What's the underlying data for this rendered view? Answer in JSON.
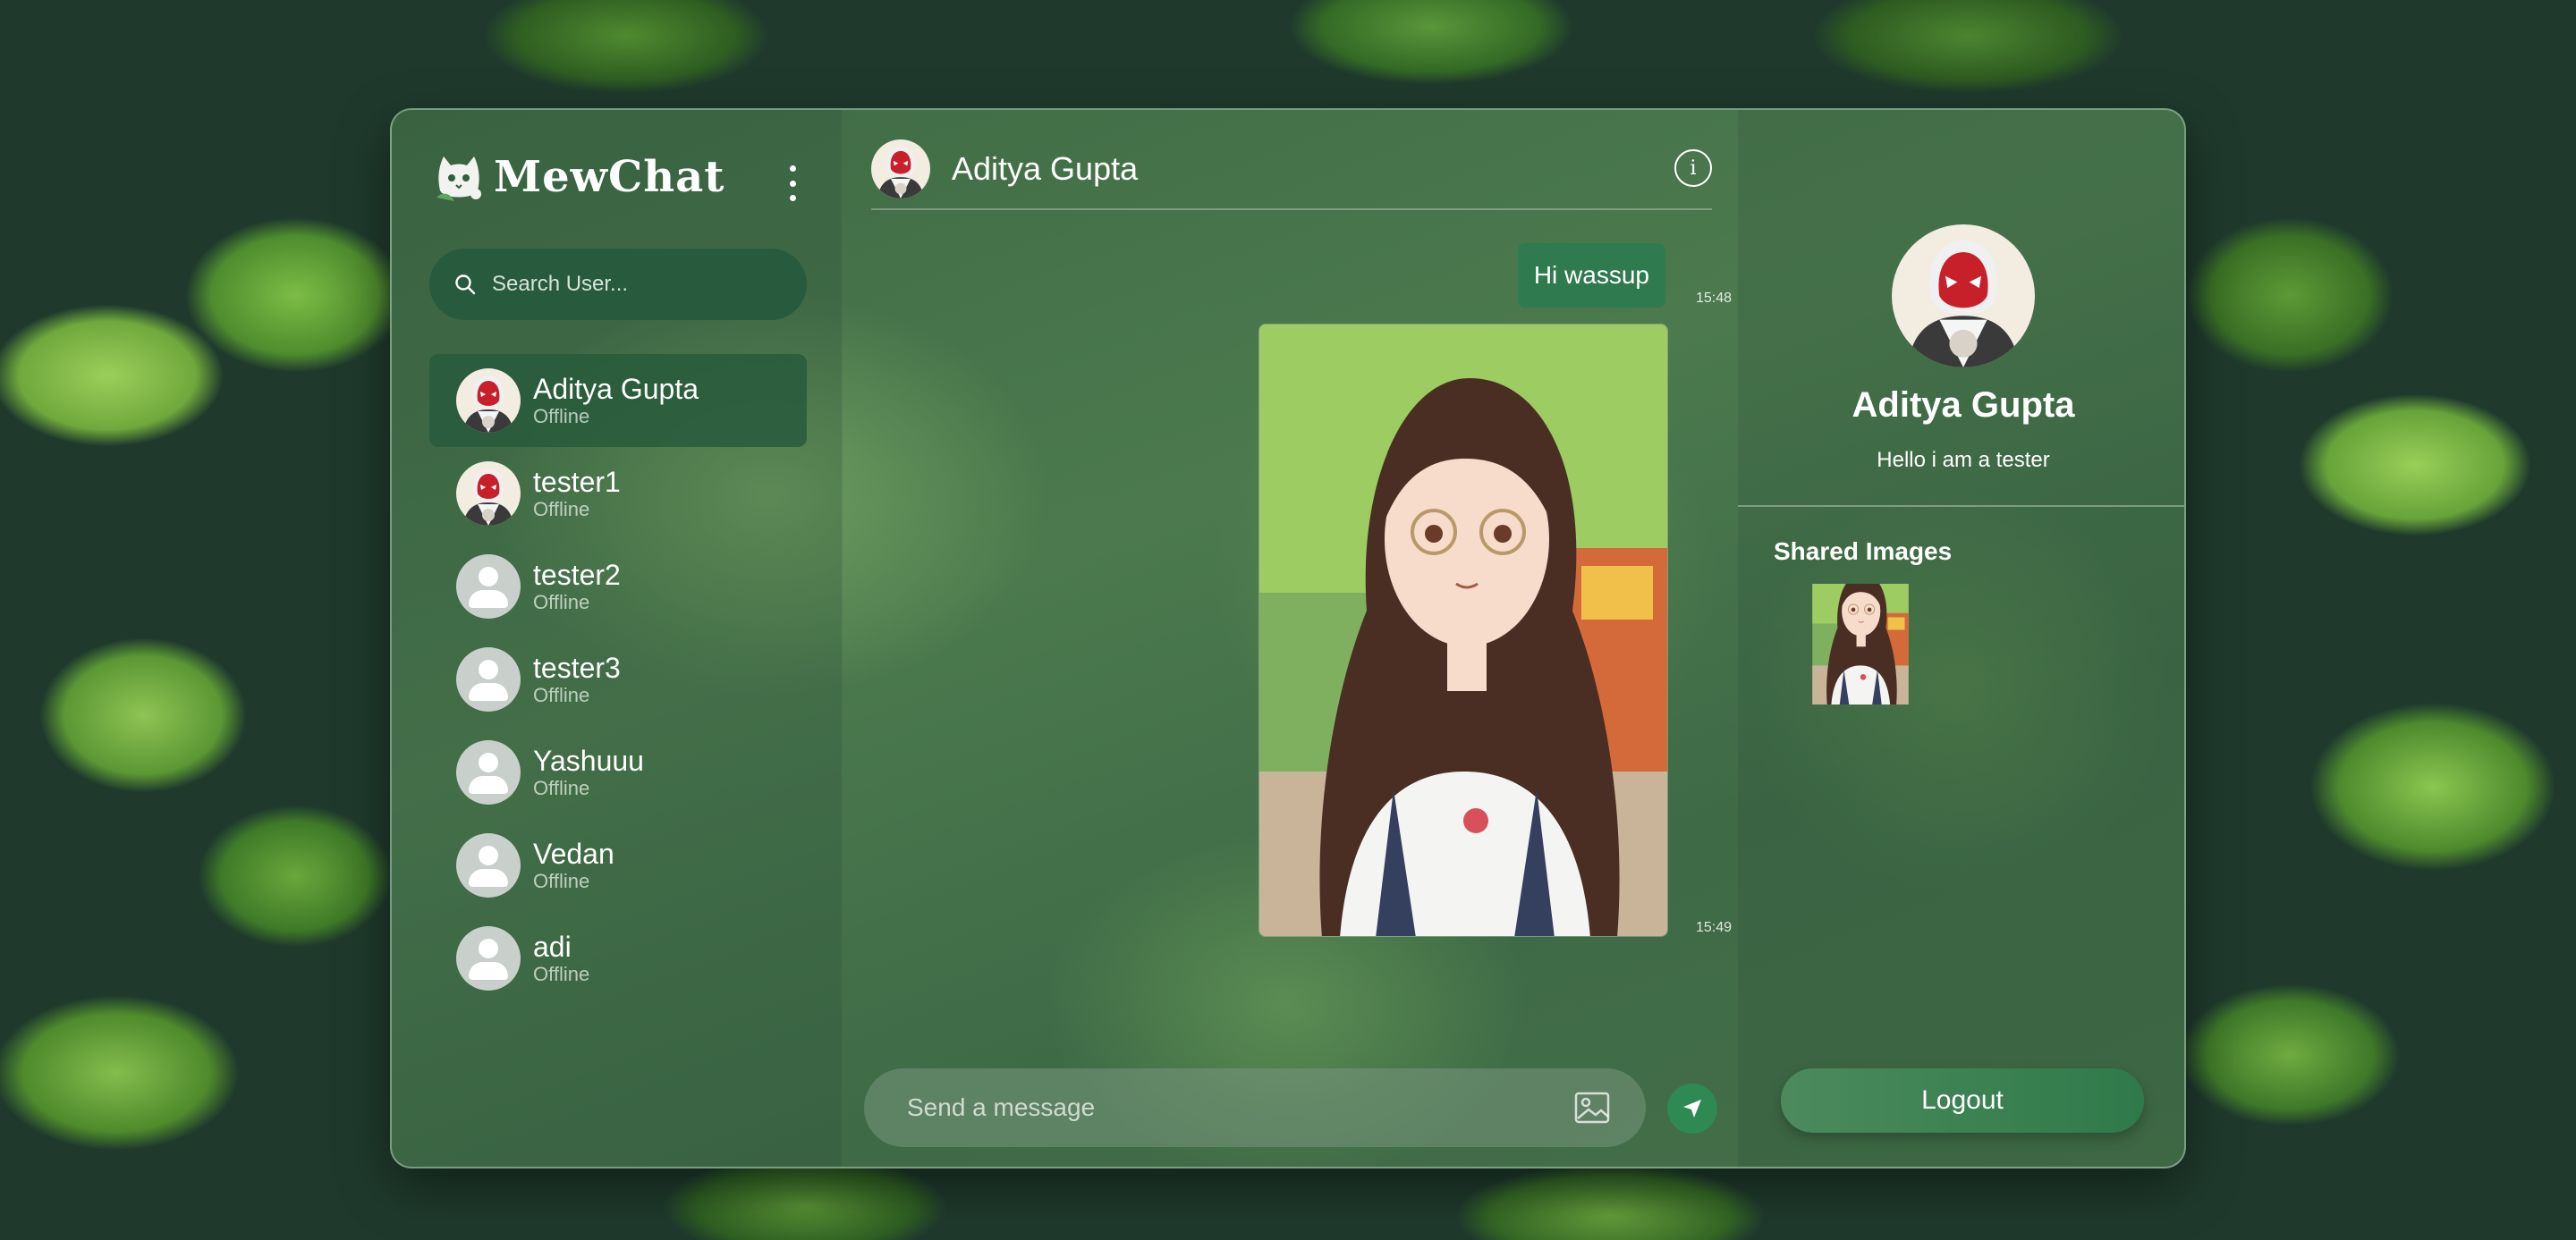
{
  "brand": {
    "name": "MewChat"
  },
  "search": {
    "placeholder": "Search User..."
  },
  "users": [
    {
      "name": "Aditya Gupta",
      "status": "Offline",
      "avatar": "spider-avatar",
      "active": true
    },
    {
      "name": "tester1",
      "status": "Offline",
      "avatar": "spider-avatar"
    },
    {
      "name": "tester2",
      "status": "Offline",
      "avatar": "default-avatar"
    },
    {
      "name": "tester3",
      "status": "Offline",
      "avatar": "default-avatar"
    },
    {
      "name": "Yashuuu",
      "status": "Offline",
      "avatar": "default-avatar"
    },
    {
      "name": "Vedan",
      "status": "Offline",
      "avatar": "default-avatar"
    },
    {
      "name": "adi",
      "status": "Offline",
      "avatar": "default-avatar"
    }
  ],
  "chat": {
    "title": "Aditya Gupta",
    "messages": [
      {
        "type": "text",
        "text": "Hi wassup",
        "time": "15:48"
      },
      {
        "type": "image",
        "image": "anime-girl-photo",
        "time": "15:49"
      }
    ],
    "input_placeholder": "Send a message"
  },
  "profile": {
    "name": "Aditya Gupta",
    "bio": "Hello i am a tester",
    "shared_images_title": "Shared Images",
    "logout_label": "Logout"
  },
  "icons": {
    "search": "search-icon",
    "menu": "kebab-menu-icon",
    "info": "info-icon",
    "image": "image-upload-icon",
    "send": "send-icon"
  },
  "colors": {
    "accent": "#2e8a52",
    "search_bg": "#285a3d",
    "bubble": "#2f7a4e"
  }
}
